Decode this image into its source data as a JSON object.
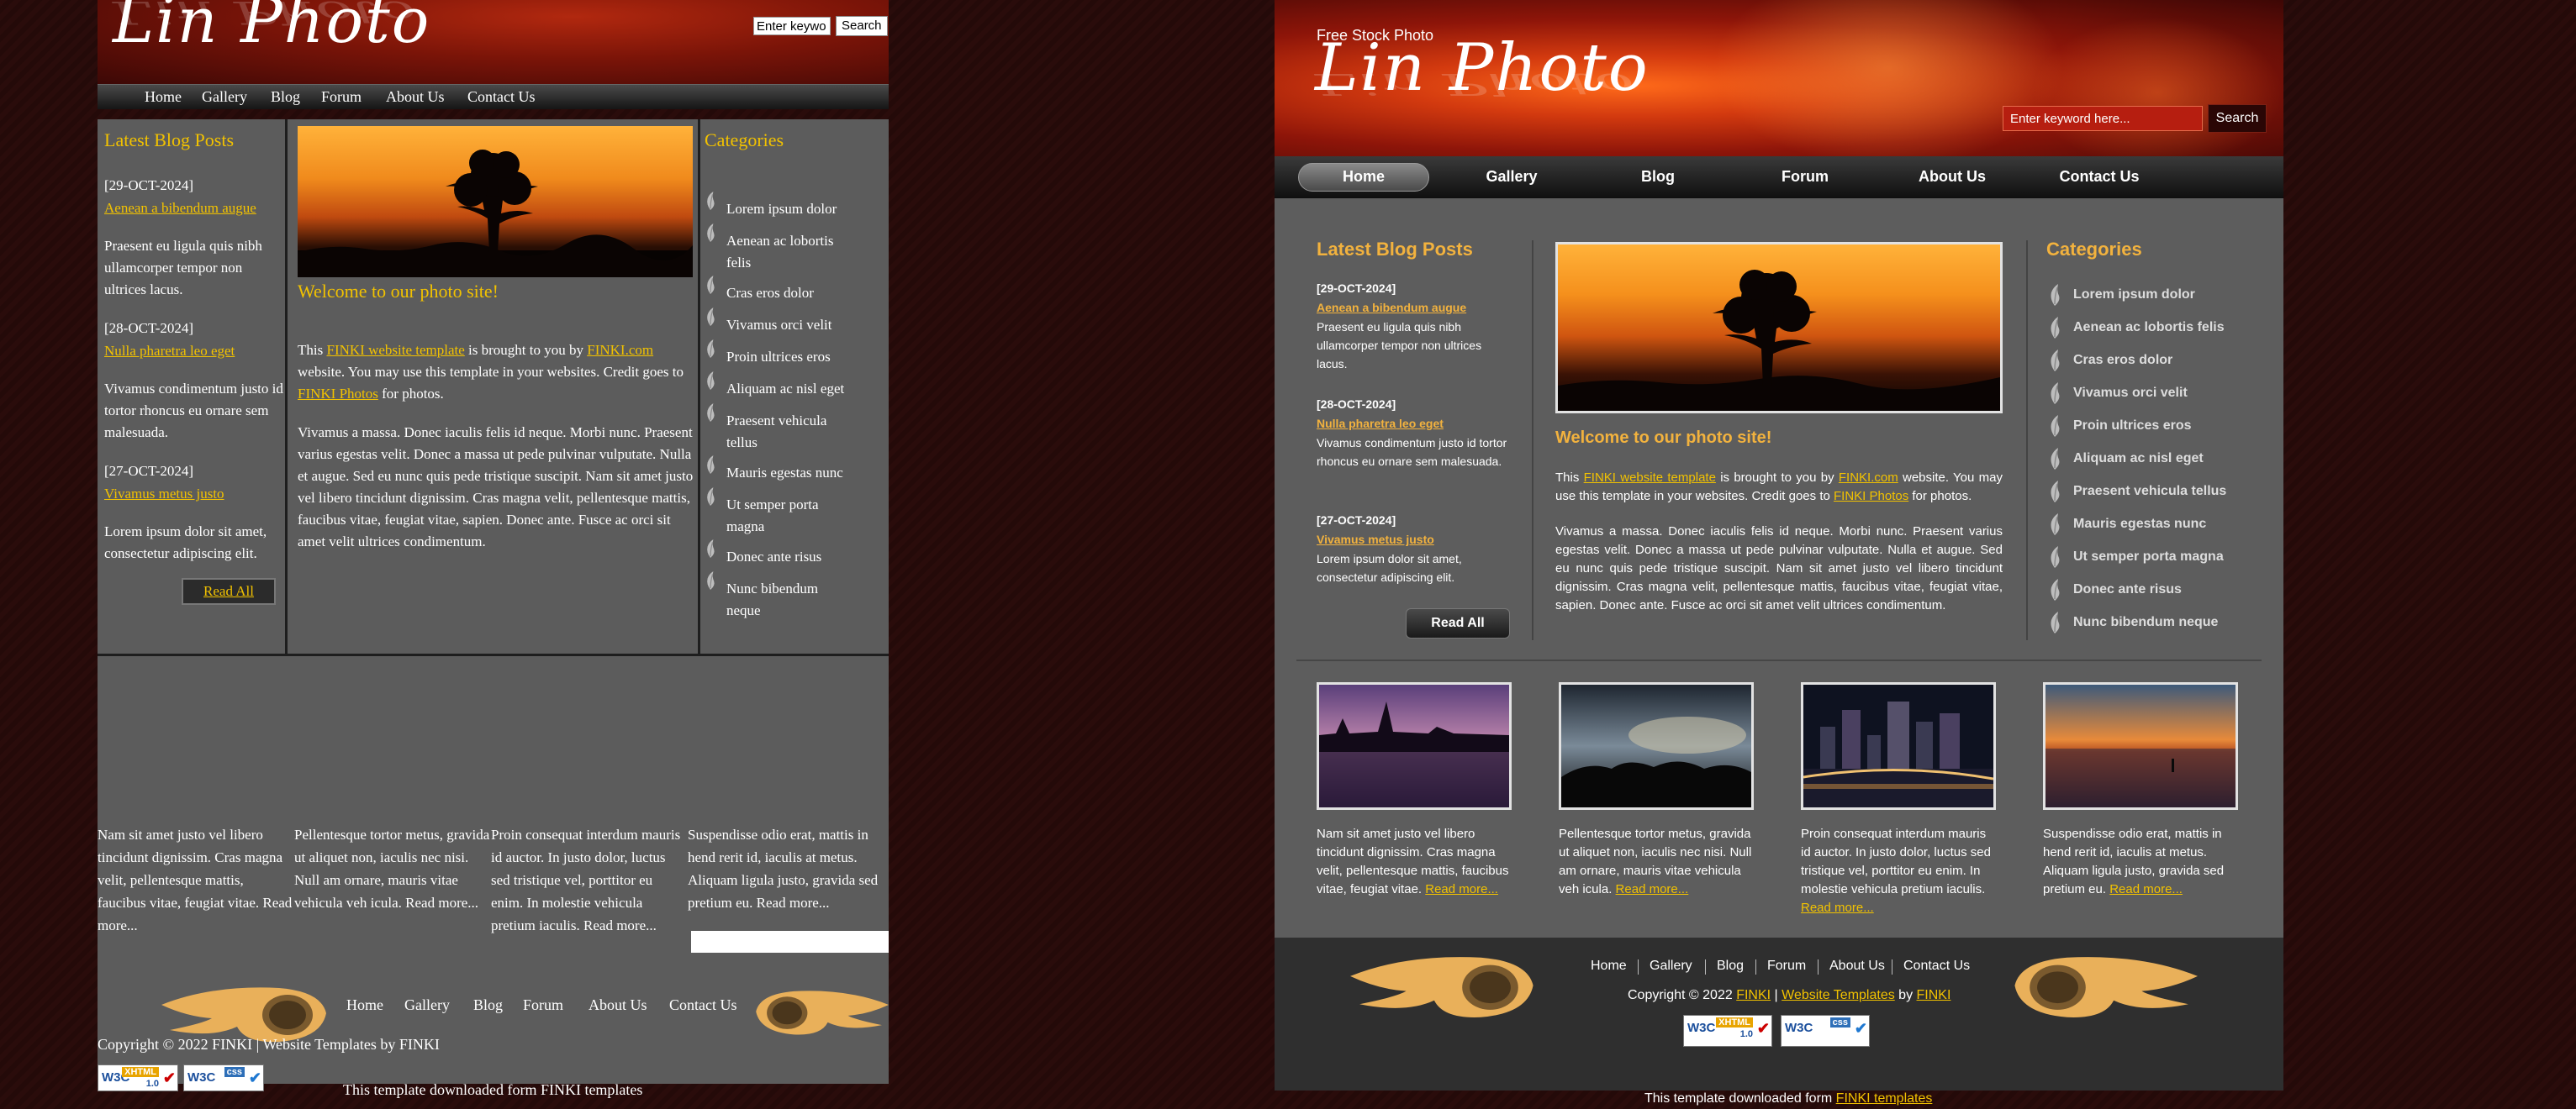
{
  "site": {
    "tagline": "Free Stock Photo",
    "logo": "Lin Photo"
  },
  "search": {
    "left_placeholder": "Enter keywo",
    "right_placeholder": "Enter keyword here...",
    "button": "Search"
  },
  "nav": [
    "Home",
    "Gallery",
    "Blog",
    "Forum",
    "About Us",
    "Contact Us"
  ],
  "blog": {
    "title": "Latest Blog Posts",
    "posts": [
      {
        "date": "[29-OCT-2024]",
        "title": "Aenean a bibendum augue",
        "text": "Praesent eu ligula quis nibh ullamcorper tempor non ultrices lacus."
      },
      {
        "date": "[28-OCT-2024]",
        "title": "Nulla pharetra leo eget",
        "text": "Vivamus condimentum justo id tortor rhoncus eu ornare sem malesuada."
      },
      {
        "date": "[27-OCT-2024]",
        "title": "Vivamus metus justo",
        "text": "Lorem ipsum dolor sit amet, consectetur adipiscing elit."
      }
    ],
    "read_all": "Read All"
  },
  "welcome": {
    "title": "Welcome to our photo site!",
    "p1_a": "This ",
    "p1_link1": "FINKI website template",
    "p1_b": " is brought to you by ",
    "p1_link2": "FINKI.com",
    "p1_c": " website. You may use this template in your websites. Credit goes to ",
    "p1_link3": "FINKI Photos",
    "p1_d": " for photos.",
    "p2": "Vivamus a massa. Donec iaculis felis id neque. Morbi nunc. Praesent varius egestas velit. Donec a massa ut pede pulvinar vulputate. Nulla et augue. Sed eu nunc quis pede tristique suscipit. Nam sit amet justo vel libero tincidunt dignissim. Cras magna velit, pellentesque mattis, faucibus vitae, feugiat vitae, sapien. Donec ante. Fusce ac orci sit amet velit ultrices condimentum."
  },
  "categories": {
    "title": "Categories",
    "items": [
      "Lorem ipsum dolor",
      "Aenean ac lobortis felis",
      "Cras eros dolor",
      "Vivamus orci velit",
      "Proin ultrices eros",
      "Aliquam ac nisl eget",
      "Praesent vehicula tellus",
      "Mauris egestas nunc",
      "Ut semper porta magna",
      "Donec ante risus",
      "Nunc bibendum neque"
    ]
  },
  "gallery": [
    {
      "text": "Nam sit amet justo vel libero tincidunt dignissim. Cras magna velit, pellentesque mattis, faucibus vitae, feugiat vitae.",
      "more": "Read more..."
    },
    {
      "text": "Pellentesque tortor metus, gravida ut aliquet non, iaculis nec nisi. Null am ornare, mauris vitae vehicula veh icula.",
      "more": "Read more..."
    },
    {
      "text": "Proin consequat interdum mauris id auctor. In justo dolor, luctus sed tristique vel, porttitor eu enim. In molestie vehicula pretium iaculis.",
      "more": "Read more..."
    },
    {
      "text": "Suspendisse odio erat, mattis in hend rerit id, iaculis at metus. Aliquam ligula justo, gravida sed pretium eu.",
      "more": "Read more..."
    }
  ],
  "gallery_left_text": [
    "Nam sit amet justo vel libero tincidunt dignissim. Cras magna velit, pellentesque mattis, faucibus vitae, feugiat vitae.",
    "Pellentesque tortor metus, gravida ut aliquet non, iaculis nec nisi. Null am ornare, mauris vitae vehicula veh icula.",
    "Proin consequat interdum mauris id auctor. In justo dolor, luctus sed tristique vel, porttitor eu enim. In molestie vehicula pretium iaculis.",
    "Suspendisse odio erat, mattis in hend rerit id, iaculis at metus. Aliquam ligula justo, gravida sed pretium eu."
  ],
  "footer": {
    "left_copyright": "Copyright © 2022 FINKI | Website Templates by FINKI",
    "copy_a": "Copyright © 2022 ",
    "copy_link1": "FINKI",
    "copy_b": " | ",
    "copy_link2": "Website Templates",
    "copy_c": " by ",
    "copy_link3": "FINKI",
    "credit_a": "This template downloaded form ",
    "credit_link": "FINKI templates",
    "left_credit": "This template downloaded form FINKI templates"
  },
  "badges": {
    "w3c": "W3C",
    "xhtml": "XHTML",
    "xhtml_ver": "1.0",
    "css": "css"
  },
  "icons": {
    "category_bullet": "leaf-icon",
    "footer_emblem": "flame-emblem-icon",
    "badge_check": "check-icon"
  },
  "colors": {
    "accent": "#f2b23e",
    "link": "#f2c200",
    "panel": "#5d5d5d",
    "footer": "#2f2f2f"
  }
}
